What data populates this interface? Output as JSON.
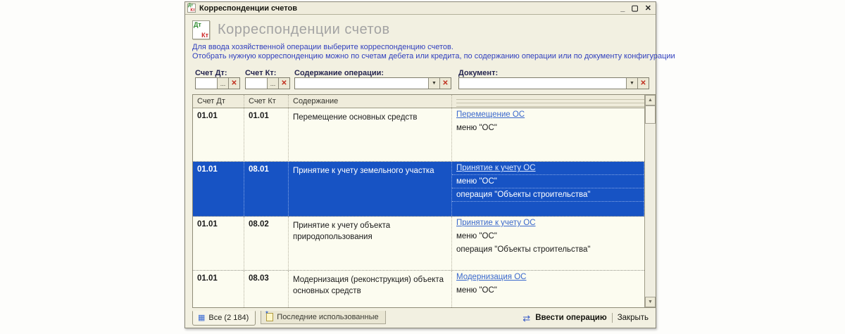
{
  "window": {
    "title": "Корреспонденции счетов",
    "controls": {
      "minimize": "_",
      "maximize": "▢",
      "close": "✕"
    }
  },
  "icons": {
    "dt_letters": "Дт",
    "kt_letters": "Кт",
    "ellipsis": "...",
    "dropdown": "▼",
    "clear": "✕",
    "scroll_up": "▲",
    "scroll_down": "▼",
    "all_tab_grid": "▦",
    "enter_operation": "⇄"
  },
  "header": {
    "title": "Корреспонденции счетов",
    "help_line1": "Для ввода хозяйственной операции выберите корреспонденцию счетов.",
    "help_line2": "Отобрать нужную корреспонденцию можно по счетам дебета или кредита, по содержанию операции или по документу конфигурации"
  },
  "filters": {
    "debit": {
      "label": "Счет Дт:",
      "value": ""
    },
    "credit": {
      "label": "Счет Кт:",
      "value": ""
    },
    "content": {
      "label": "Содержание операции:",
      "value": ""
    },
    "document": {
      "label": "Документ:",
      "value": ""
    }
  },
  "table": {
    "columns": [
      "Счет Дт",
      "Счет Кт",
      "Содержание"
    ],
    "rows": [
      {
        "dt": "01.01",
        "kt": "01.01",
        "content": "Перемещение основных средств",
        "selected": false,
        "doc_lines": [
          "Перемещение ОС",
          "меню \"ОС\""
        ]
      },
      {
        "dt": "01.01",
        "kt": "08.01",
        "content": "Принятие к учету земельного участка",
        "selected": true,
        "doc_lines": [
          "Принятие к учету ОС",
          "меню \"ОС\"",
          "операция \"Объекты строительства\"",
          ""
        ]
      },
      {
        "dt": "01.01",
        "kt": "08.02",
        "content": "Принятие к учету объекта природопользования",
        "selected": false,
        "doc_lines": [
          "Принятие к учету ОС",
          "меню \"ОС\"",
          "операция \"Объекты строительства\""
        ]
      },
      {
        "dt": "01.01",
        "kt": "08.03",
        "content": "Модернизация (реконструкция) объекта основных средств",
        "selected": false,
        "doc_lines": [
          "Модернизация ОС",
          "меню \"ОС\""
        ]
      }
    ]
  },
  "tabs": {
    "all": {
      "label": "Все (2 184)"
    },
    "recent": {
      "label": "Последние использованные"
    }
  },
  "footer": {
    "enter_operation": "Ввести операцию",
    "close": "Закрыть"
  },
  "colors": {
    "selected_row": "#1753C4",
    "link": "#3A68CC",
    "link_on_selected": "#DCE8FF",
    "help_text": "#3140BE",
    "heading": "#A3A3A3",
    "clear_button_red": "#C03020",
    "window_background": "#F2F0E1"
  }
}
